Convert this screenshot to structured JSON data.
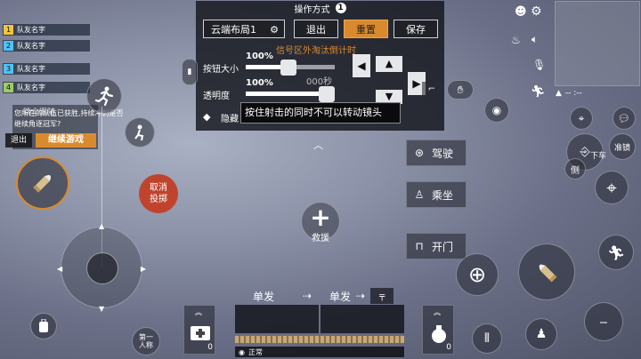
{
  "team": {
    "members": [
      {
        "num": "1",
        "name": "队友名字",
        "color": "#f0c63a"
      },
      {
        "num": "2",
        "name": "队友名字",
        "color": "#4fc3f7"
      },
      {
        "num": "3",
        "name": "队友名字",
        "color": "#4fc3f7"
      },
      {
        "num": "4",
        "name": "队友名字",
        "color": "#9ccc65"
      }
    ]
  },
  "follow": {
    "title": "跳伞跟随",
    "message": "您所在的队伍已获胜,持续冲刺是否继续角逐冠军?",
    "exit_label": "退出",
    "continue_label": "继续游戏"
  },
  "panel": {
    "title": "操作方式",
    "mode_number": "1",
    "layout_name": "云端布局1",
    "exit_label": "退出",
    "reset_label": "重置",
    "save_label": "保存",
    "size_label": "按钮大小",
    "size_value": "100%",
    "size_level": 0.47,
    "opacity_label": "透明度",
    "opacity_value": "100%",
    "opacity_level": 1.0,
    "hide_label": "隐藏",
    "notice": "信号区外淘汰倒计时",
    "timer_text": "000秒",
    "tooltip": "按住射击的同时不可以转动镜头"
  },
  "actions": {
    "cancel_throw": "取消\n投掷",
    "rescue": "救援",
    "drive": "驾驶",
    "ride": "乘坐",
    "open_door": "开门",
    "get_off": "下车",
    "aim": "准镜",
    "first_person": "第一\n人称"
  },
  "fire_modes": {
    "left_label": "单发",
    "right_label": "单发",
    "stance_label": "正常",
    "medkit_count": "0",
    "grenade_count": "0"
  },
  "minimap": {
    "readout": "-- :--"
  },
  "colors": {
    "accent_orange": "#d98a2e",
    "cancel_red": "#c0442d",
    "panel_bg": "#1c1e24"
  }
}
